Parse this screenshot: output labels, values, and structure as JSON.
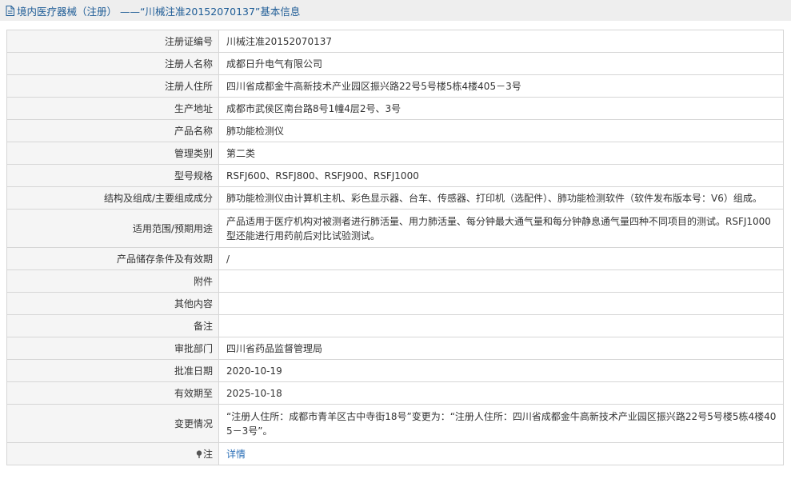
{
  "header": {
    "title": "境内医疗器械（注册） ——“川械注准20152070137”基本信息"
  },
  "rows": [
    {
      "label": "注册证编号",
      "value": "川械注准20152070137"
    },
    {
      "label": "注册人名称",
      "value": "成都日升电气有限公司"
    },
    {
      "label": "注册人住所",
      "value": "四川省成都金牛高新技术产业园区振兴路22号5号楼5栋4楼405－3号"
    },
    {
      "label": "生产地址",
      "value": "成都市武侯区南台路8号1幢4层2号、3号"
    },
    {
      "label": "产品名称",
      "value": "肺功能检测仪"
    },
    {
      "label": "管理类别",
      "value": "第二类"
    },
    {
      "label": "型号规格",
      "value": "RSFJ600、RSFJ800、RSFJ900、RSFJ1000"
    },
    {
      "label": "结构及组成/主要组成成分",
      "value": "肺功能检测仪由计算机主机、彩色显示器、台车、传感器、打印机（选配件）、肺功能检测软件（软件发布版本号：V6）组成。"
    },
    {
      "label": "适用范围/预期用途",
      "value": "产品适用于医疗机构对被测者进行肺活量、用力肺活量、每分钟最大通气量和每分钟静息通气量四种不同项目的测试。RSFJ1000型还能进行用药前后对比试验测试。"
    },
    {
      "label": "产品储存条件及有效期",
      "value": "/"
    },
    {
      "label": "附件",
      "value": ""
    },
    {
      "label": "其他内容",
      "value": ""
    },
    {
      "label": "备注",
      "value": ""
    },
    {
      "label": "审批部门",
      "value": "四川省药品监督管理局"
    },
    {
      "label": "批准日期",
      "value": "2020-10-19"
    },
    {
      "label": "有效期至",
      "value": "2025-10-18"
    },
    {
      "label": "变更情况",
      "value": "“注册人住所：成都市青羊区古中寺街18号”变更为：“注册人住所：四川省成都金牛高新技术产业园区振兴路22号5号楼5栋4楼405－3号”。"
    }
  ],
  "note": {
    "label": "注",
    "link_text": "详情",
    "icon": "pin-icon"
  },
  "colors": {
    "header_text": "#1e5c96",
    "header_bg": "#eeeeee",
    "label_bg": "#f5f5f5",
    "link": "#2b6fb7",
    "border": "#d6d6d6"
  }
}
